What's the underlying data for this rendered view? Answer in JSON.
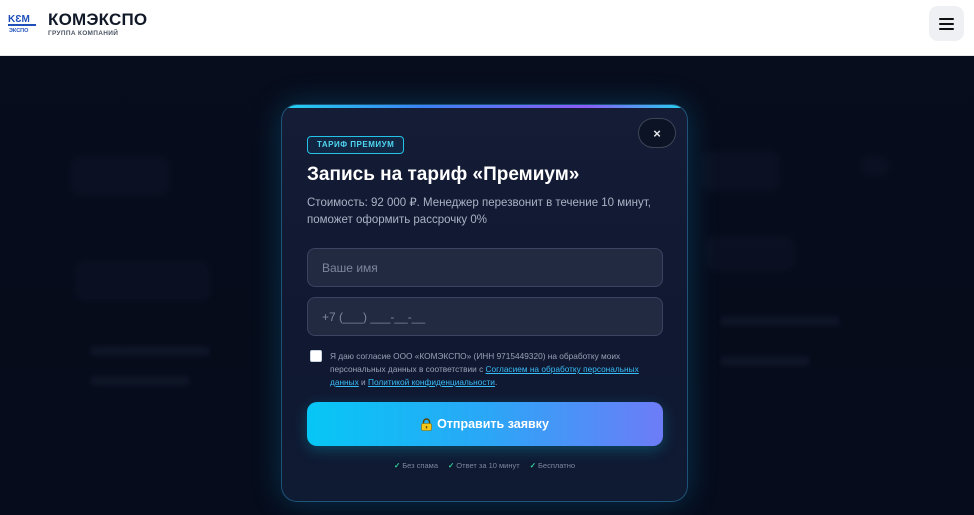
{
  "header": {
    "brand_name": "КОМЭКСПО",
    "brand_sub": "ГРУППА КОМПАНИЙ",
    "logo_icon": "komexpo-logo-icon",
    "menu_icon": "hamburger-menu-icon"
  },
  "modal": {
    "badge": "ТАРИФ ПРЕМИУМ",
    "title": "Запись на тариф «Премиум»",
    "description": "Стоимость: 92 000 ₽. Менеджер перезвонит в течение 10 минут, поможет оформить рассрочку 0%",
    "close_label": "×",
    "name_placeholder": "Ваше имя",
    "phone_placeholder": "+7 (___) ___-__-__",
    "consent": {
      "text_before": "Я даю согласие ООО «КОМЭКСПО» (ИНН 9715449320) на обработку моих персональных данных в соответствии с ",
      "link_agreement": "Согласием на обработку персональных данных",
      "text_between": " и ",
      "link_policy": "Политикой конфиденциальности",
      "text_after": "."
    },
    "submit_label": "Отправить заявку",
    "submit_icon": "lock-icon",
    "perks": [
      {
        "check": "✓",
        "label": "Без спама"
      },
      {
        "check": "✓",
        "label": "Ответ за 10 минут"
      },
      {
        "check": "✓",
        "label": "Бесплатно"
      }
    ]
  },
  "colors": {
    "accent_cyan": "#06c7f5",
    "accent_violet": "#6d7cf7",
    "badge": "#22c3e6",
    "perk_check": "#34d399"
  }
}
